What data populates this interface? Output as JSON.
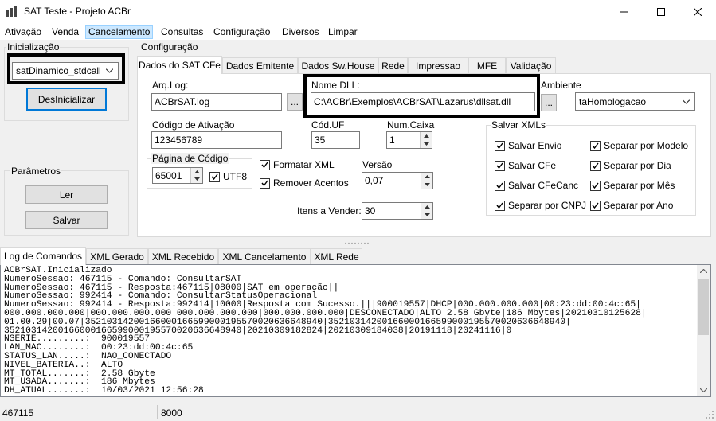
{
  "window": {
    "title": "SAT Teste - Projeto ACBr",
    "minimize": "—",
    "maximize": "☐",
    "close": "✕"
  },
  "menu": [
    "Ativação",
    "Venda",
    "Cancelamento",
    "Consultas",
    "Configuração",
    "Diversos",
    "Limpar"
  ],
  "left": {
    "init_label": "Inicialização",
    "model_value": "satDinamico_stdcall",
    "deinit_button": "DesInicializar",
    "params_label": "Parâmetros",
    "read_button": "Ler",
    "save_button": "Salvar"
  },
  "config": {
    "label": "Configuração",
    "tabs": [
      "Dados do SAT CFe",
      "Dados Emitente",
      "Dados Sw.House",
      "Rede",
      "Impressao",
      "MFE",
      "Validação"
    ],
    "arq_log_label": "Arq.Log:",
    "arq_log_value": "ACBrSAT.log",
    "browse": "...",
    "dll_label": "Nome DLL:",
    "dll_value": "C:\\ACBr\\Exemplos\\ACBrSAT\\Lazarus\\dllsat.dll",
    "ambiente_label": "Ambiente",
    "ambiente_value": "taHomologacao",
    "cod_ativ_label": "Código de Ativação",
    "cod_ativ_value": "123456789",
    "cod_uf_label": "Cód.UF",
    "cod_uf_value": "35",
    "num_caixa_label": "Num.Caixa",
    "num_caixa_value": "1",
    "pagina_label": "Página de Código",
    "pagina_value": "65001",
    "utf8_label": "UTF8",
    "formatar_label": "Formatar XML",
    "remover_label": "Remover Acentos",
    "versao_label": "Versão",
    "versao_value": "0,07",
    "itens_label": "Itens a Vender:",
    "itens_value": "30",
    "salvar_xmls_label": "Salvar XMLs",
    "salvar_envio": "Salvar Envio",
    "salvar_cfe": "Salvar CFe",
    "salvar_cfecanc": "Salvar CFeCanc",
    "separar_cnpj": "Separar por CNPJ",
    "separar_modelo": "Separar por Modelo",
    "separar_dia": "Separar por Dia",
    "separar_mes": "Separar por Mês",
    "separar_ano": "Separar por Ano"
  },
  "log": {
    "tabs": [
      "Log de Comandos",
      "XML Gerado",
      "XML Recebido",
      "XML Cancelamento",
      "XML Rede"
    ],
    "lines": [
      "ACBrSAT.Inicializado",
      "NumeroSessao: 467115 - Comando: ConsultarSAT",
      "NumeroSessao: 467115 - Resposta:467115|08000|SAT em operação||",
      "NumeroSessao: 992414 - Comando: ConsultarStatusOperacional",
      "NumeroSessao: 992414 - Resposta:992414|10000|Resposta com Sucesso.|||900019557|DHCP|000.000.000.000|00:23:dd:00:4c:65|",
      "000.000.000.000|000.000.000.000|000.000.000.000|000.000.000.000|DESCONECTADO|ALTO|2.58 Gbyte|186 Mbytes|20210310125628|",
      "01.00.29|00.07|35210314200166000166599000195570020636648940|35210314200166000166599000195570020636648940|",
      "35210314200166000166599000195570020636648940|20210309182824|20210309184038|20191118|20241116|0",
      "NSERIE.........:  900019557",
      "LAN_MAC........:  00:23:dd:00:4c:65",
      "STATUS_LAN.....:  NAO_CONECTADO",
      "NIVEL_BATERIA..:  ALTO",
      "MT_TOTAL.......:  2.58 Gbyte",
      "MT_USADA.......:  186 Mbytes",
      "DH_ATUAL.......:  10/03/2021 12:56:28"
    ]
  },
  "status": {
    "left": "467115",
    "right": "8000"
  }
}
